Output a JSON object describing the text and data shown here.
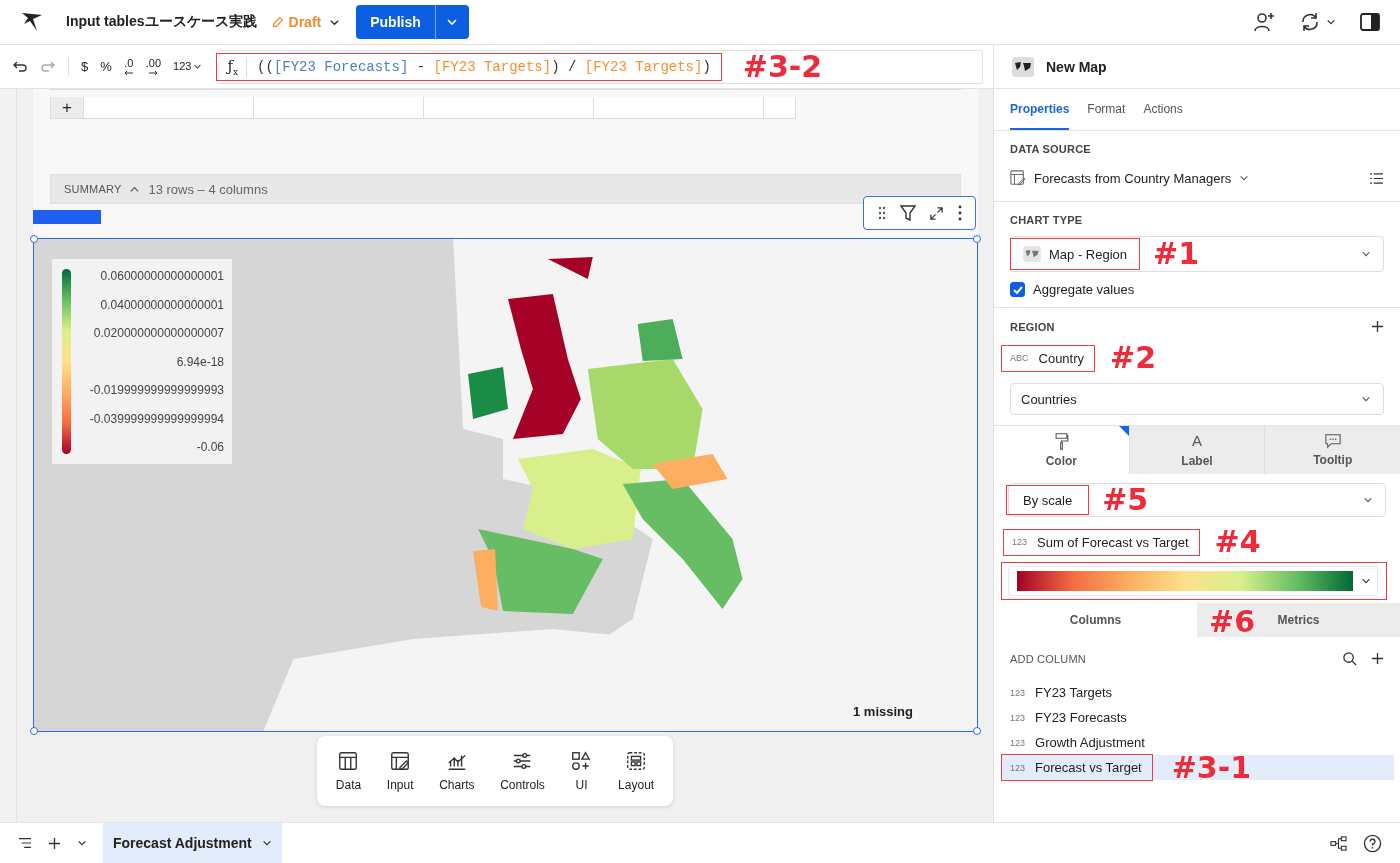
{
  "app_bar": {
    "title": "Input tablesユースケース実践",
    "status": "Draft",
    "publish_button": "Publish"
  },
  "format_toolbar": {
    "buttons": [
      {
        "kind": "currency",
        "label": "$"
      },
      {
        "kind": "percent",
        "label": "%"
      },
      {
        "kind": "decrease",
        "label": ".0"
      },
      {
        "kind": "increase",
        "label": ".00"
      },
      {
        "kind": "number",
        "label": "123"
      }
    ]
  },
  "formula_bar": {
    "annotation": "#3-2",
    "function_label": "ƒ$_{x}$",
    "tokens": [
      {
        "text": "((",
        "color": "#333333"
      },
      {
        "text": "[FY23 Forecasts]",
        "color": "#4a7fc1"
      },
      {
        "text": " - ",
        "color": "#333333"
      },
      {
        "text": "[FY23 Targets]",
        "color": "#f0922e"
      },
      {
        "text": ") / ",
        "color": "#333333"
      },
      {
        "text": "[FY23 Targets]",
        "color": "#f0922e"
      },
      {
        "text": ")",
        "color": "#333333"
      }
    ]
  },
  "canvas": {
    "table": {
      "add_row": "+"
    },
    "summary": {
      "label": "SUMMARY",
      "info": "13 rows – 4 columns"
    },
    "map": {
      "legend": [
        "0.06000000000000001",
        "0.04000000000000001",
        "0.020000000000000007",
        "6.94e-18",
        "-0.019999999999999993",
        "-0.039999999999999994",
        "-0.06"
      ],
      "missing": "1 missing"
    },
    "add_toolbar": [
      {
        "kind": "data",
        "label": "Data"
      },
      {
        "kind": "input",
        "label": "Input"
      },
      {
        "kind": "charts",
        "label": "Charts"
      },
      {
        "kind": "controls",
        "label": "Controls"
      },
      {
        "kind": "ui",
        "label": "UI"
      },
      {
        "kind": "layout",
        "label": "Layout"
      }
    ]
  },
  "panel": {
    "title": "New Map",
    "tabs": [
      {
        "label": "Properties",
        "selected": true
      },
      {
        "label": "Format",
        "selected": false
      },
      {
        "label": "Actions",
        "selected": false
      }
    ],
    "data_source": {
      "heading": "DATA SOURCE",
      "value": "Forecasts from Country Managers"
    },
    "chart_type": {
      "heading": "CHART TYPE",
      "value": "Map - Region",
      "annotation": "#1",
      "aggregate": {
        "label": "Aggregate values",
        "checked": true
      }
    },
    "region": {
      "heading": "REGION",
      "field": {
        "type": "ABC",
        "label": "Country",
        "annotation": "#2"
      },
      "select": "Countries"
    },
    "mark_tabs": [
      {
        "kind": "color",
        "label": "Color",
        "selected": true
      },
      {
        "kind": "label",
        "label": "Label",
        "glyph": "A",
        "selected": false
      },
      {
        "kind": "tooltip",
        "label": "Tooltip",
        "selected": false
      }
    ],
    "color": {
      "mode": "By scale",
      "mode_annotation": "#5",
      "field": {
        "type": "123",
        "label": "Sum of Forecast vs Target",
        "annotation": "#4"
      },
      "scale_annotation": "#6"
    },
    "list_tabs": [
      {
        "label": "Columns",
        "selected": true
      },
      {
        "label": "Metrics",
        "selected": false
      }
    ],
    "add_column": "ADD COLUMN",
    "columns": [
      {
        "type": "123",
        "label": "FY23 Targets",
        "selected": false
      },
      {
        "type": "123",
        "label": "FY23 Forecasts",
        "selected": false
      },
      {
        "type": "123",
        "label": "Growth Adjustment",
        "selected": false
      },
      {
        "type": "123",
        "label": "Forecast vs Target",
        "selected": true,
        "annotation": "#3-1"
      }
    ]
  },
  "page_tabs": [
    {
      "label": "Forecast Adjustment",
      "selected": true
    }
  ]
}
